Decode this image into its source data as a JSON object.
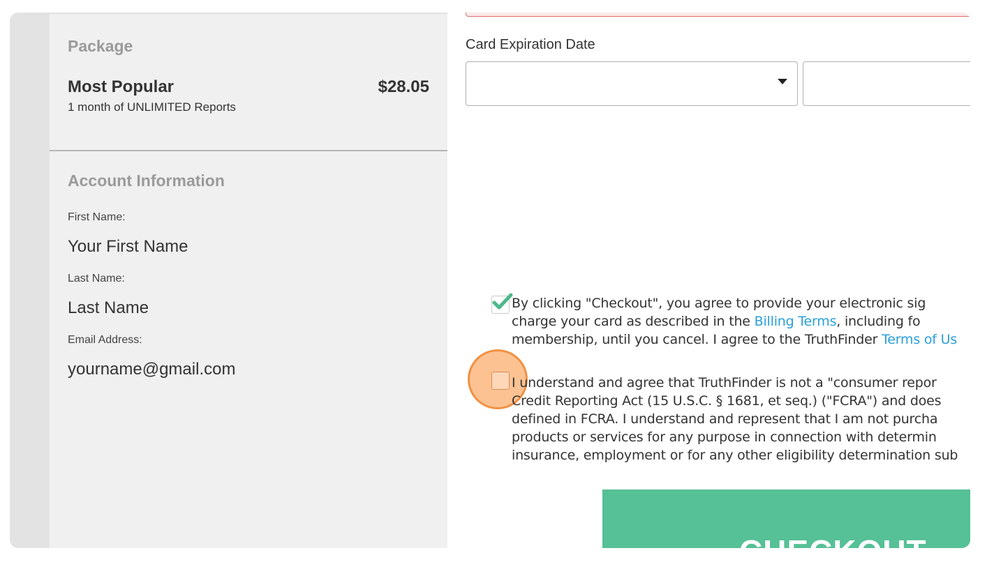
{
  "package": {
    "heading": "Package",
    "name": "Most Popular",
    "price": "$28.05",
    "description": "1 month of UNLIMITED Reports"
  },
  "account": {
    "heading": "Account Information",
    "first_name_label": "First Name:",
    "first_name_value": "Your First Name",
    "last_name_label": "Last Name:",
    "last_name_value": "Last Name",
    "email_label": "Email Address:",
    "email_value": "yourname@gmail.com"
  },
  "payment": {
    "expiration_label": "Card Expiration Date",
    "month_value": "",
    "year_value": ""
  },
  "agreement_1": {
    "checked": true,
    "line1": "By clicking \"Checkout\", you agree to provide your electronic sig",
    "line2_pre": "charge your card as described in the ",
    "line2_link": "Billing Terms",
    "line2_post": ", including fo",
    "line3_pre": "membership, until you cancel. I agree to the TruthFinder ",
    "line3_link": "Terms of Us"
  },
  "agreement_2": {
    "checked": false,
    "line1": "I understand and agree that TruthFinder is not a \"consumer repor",
    "line2": "Credit Reporting Act (15 U.S.C. § 1681, et seq.) (\"FCRA\") and does",
    "line3": "defined in FCRA. I understand and represent that I am not purcha",
    "line4": "products or services for any purpose in connection with determin",
    "line5": "insurance, employment or for any other eligibility determination sub"
  },
  "checkout_label": "CHECKOUT",
  "colors": {
    "accent_green": "#56c096",
    "link_blue": "#2a9fd8",
    "check_green": "#4cb88a",
    "click_highlight": "#faa55f"
  }
}
